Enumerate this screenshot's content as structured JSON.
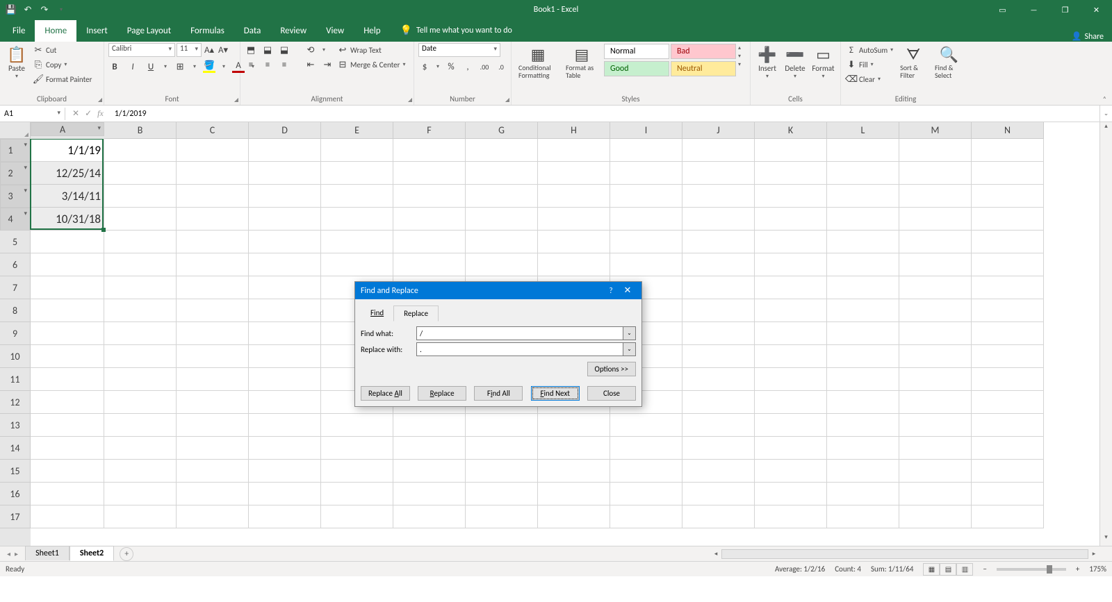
{
  "app": {
    "title": "Book1 - Excel"
  },
  "qat": {
    "save": "💾",
    "undo": "↶",
    "redo": "↷"
  },
  "win": {
    "ribbonOpts": "▭",
    "min": "—",
    "restore": "❐",
    "close": "✕"
  },
  "tabs": {
    "file": "File",
    "home": "Home",
    "insert": "Insert",
    "pageLayout": "Page Layout",
    "formulas": "Formulas",
    "data": "Data",
    "review": "Review",
    "view": "View",
    "help": "Help",
    "tellme": "Tell me what you want to do",
    "share": "Share"
  },
  "ribbon": {
    "clipboard": {
      "paste": "Paste",
      "cut": "Cut",
      "copy": "Copy",
      "formatPainter": "Format Painter",
      "label": "Clipboard"
    },
    "font": {
      "name": "Calibri",
      "size": "11",
      "label": "Font"
    },
    "alignment": {
      "wrap": "Wrap Text",
      "merge": "Merge & Center",
      "label": "Alignment"
    },
    "number": {
      "format": "Date",
      "label": "Number"
    },
    "styles": {
      "cond": "Conditional Formatting",
      "table": "Format as Table",
      "normal": "Normal",
      "bad": "Bad",
      "good": "Good",
      "neutral": "Neutral",
      "label": "Styles"
    },
    "cells": {
      "insert": "Insert",
      "delete": "Delete",
      "format": "Format",
      "label": "Cells"
    },
    "editing": {
      "autosum": "AutoSum",
      "fill": "Fill",
      "clear": "Clear",
      "sort": "Sort & Filter",
      "find": "Find & Select",
      "label": "Editing"
    }
  },
  "nameBox": "A1",
  "formulaBar": "1/1/2019",
  "columns": [
    "A",
    "B",
    "C",
    "D",
    "E",
    "F",
    "G",
    "H",
    "I",
    "J",
    "K",
    "L",
    "M",
    "N"
  ],
  "rows": [
    "1",
    "2",
    "3",
    "4",
    "5",
    "6",
    "7",
    "8",
    "9",
    "10",
    "11",
    "12",
    "13",
    "14",
    "15",
    "16",
    "17"
  ],
  "cellsData": {
    "A1": "1/1/19",
    "A2": "12/25/14",
    "A3": "3/14/11",
    "A4": "10/31/18"
  },
  "sheets": {
    "s1": "Sheet1",
    "s2": "Sheet2"
  },
  "status": {
    "ready": "Ready",
    "average": "Average: 1/2/16",
    "count": "Count: 4",
    "sum": "Sum: 1/11/64",
    "zoom": "175%"
  },
  "dialog": {
    "title": "Find and Replace",
    "tabFind": "Find",
    "tabReplace": "Replace",
    "findWhatLabel": "Find what:",
    "findWhat": "/",
    "replaceWithLabel": "Replace with:",
    "replaceWith": ".",
    "options": "Options >>",
    "replaceAll": "Replace All",
    "replace": "Replace",
    "findAll": "Find All",
    "findNext": "Find Next",
    "close": "Close"
  }
}
